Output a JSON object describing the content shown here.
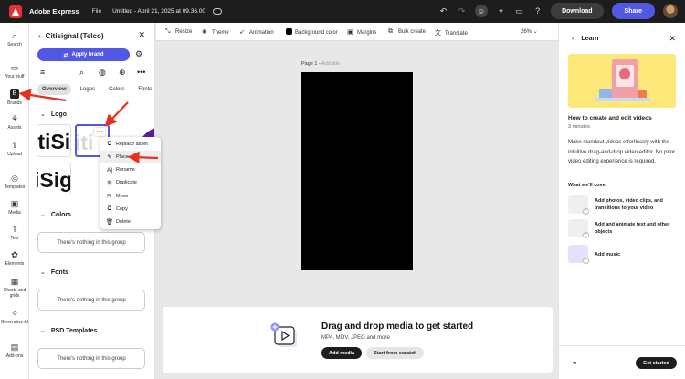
{
  "topbar": {
    "app_name": "Adobe Express",
    "file_menu": "File",
    "doc_title": "Untitled - April 21, 2025 at 09.36.00",
    "download_label": "Download",
    "share_label": "Share"
  },
  "rail": {
    "items": [
      {
        "label": "Search",
        "icon": "search-icon"
      },
      {
        "label": "Your stuff",
        "icon": "folder-icon"
      },
      {
        "label": "Brands",
        "icon": "brand-icon"
      },
      {
        "label": "Assets",
        "icon": "assets-icon"
      },
      {
        "label": "Upload",
        "icon": "upload-icon"
      },
      {
        "label": "Templates",
        "icon": "templates-icon"
      },
      {
        "label": "Media",
        "icon": "media-icon"
      },
      {
        "label": "Text",
        "icon": "text-icon"
      },
      {
        "label": "Elements",
        "icon": "elements-icon"
      },
      {
        "label": "Charts and grids",
        "icon": "chart-icon"
      },
      {
        "label": "Generative AI",
        "icon": "sparkle-icon"
      },
      {
        "label": "Add-ons",
        "icon": "addons-icon"
      }
    ]
  },
  "brand_panel": {
    "title": "Citisignal (Telco)",
    "apply_label": "Apply brand",
    "tabs": [
      "Overview",
      "Logos",
      "Colors",
      "Fonts"
    ],
    "sections": {
      "logo": "Logo",
      "colors": "Colors",
      "fonts": "Fonts",
      "psd": "PSD Templates"
    },
    "logo_texts": [
      "itiSi",
      "iti",
      "iSig"
    ],
    "empty_text": "There's nothing in this group"
  },
  "context_menu": {
    "items": [
      "Replace asset",
      "Place",
      "Rename",
      "Duplicate",
      "Move",
      "Copy",
      "Delete"
    ]
  },
  "canvas_toolbar": {
    "resize": "Resize",
    "theme": "Theme",
    "animation": "Animation",
    "background": "Background color",
    "margins": "Margins",
    "bulk": "Bulk create",
    "translate": "Translate",
    "zoom": "26%"
  },
  "canvas": {
    "page_label": "Page 1 -",
    "add_title": "Add title"
  },
  "dropzone": {
    "title": "Drag and drop media to get started",
    "subtitle": "MP4, MOV, JPEG and more",
    "add_media": "Add media",
    "start_scratch": "Start from scratch"
  },
  "learn": {
    "title": "Learn",
    "video_title": "How to create and edit videos",
    "duration": "3 minutes",
    "description": "Make standout videos effortlessly with the intuitive drag-and-drop video editor. No prior video editing experience is required.",
    "cover_heading": "What we'll cover",
    "steps": [
      "Add photos, video clips, and transitions to your video",
      "Add and animate text and other objects",
      "Add music"
    ],
    "start_label": "Get started"
  },
  "colors": {
    "accent": "#5258e4",
    "topbar": "#1d1d1d",
    "arrow": "#e8301f"
  }
}
